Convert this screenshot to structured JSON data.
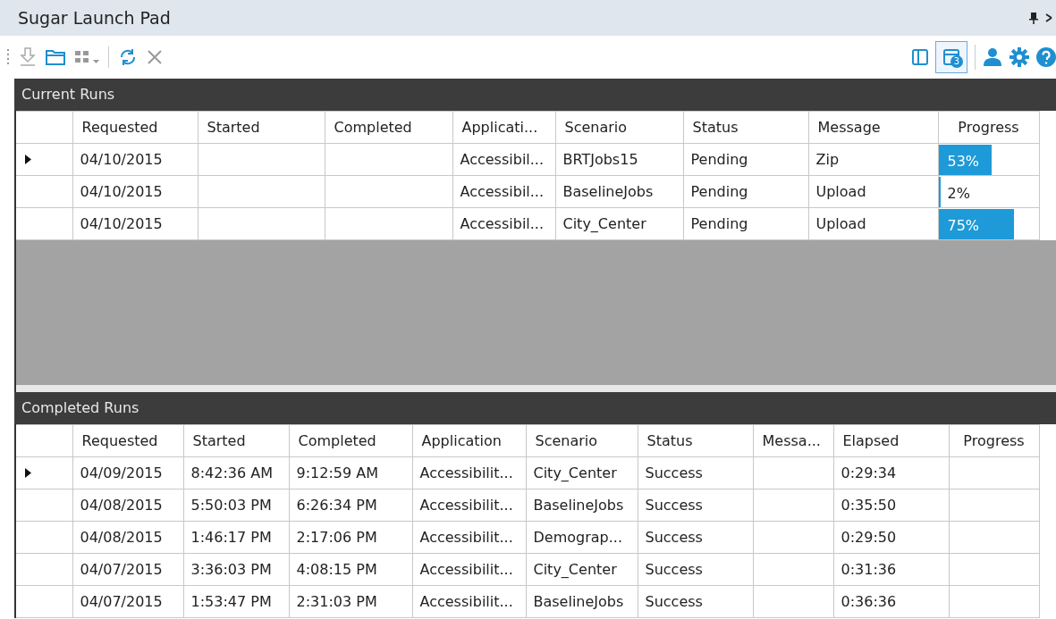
{
  "window": {
    "title": "Sugar Launch Pad"
  },
  "toolbar": {
    "badge": "3"
  },
  "current_runs": {
    "title": "Current Runs",
    "columns": [
      "Requested",
      "Started",
      "Completed",
      "Applicati...",
      "Scenario",
      "Status",
      "Message",
      "Progress"
    ],
    "rows": [
      {
        "selected": true,
        "cells": [
          "04/10/2015",
          "",
          "",
          "Accessibil...",
          "BRTJobs15",
          "Pending",
          "Zip"
        ],
        "progress": {
          "level": 0.53,
          "label": "53%"
        }
      },
      {
        "selected": false,
        "cells": [
          "04/10/2015",
          "",
          "",
          "Accessibil...",
          "BaselineJobs",
          "Pending",
          "Upload"
        ],
        "progress": {
          "level": 0.02,
          "label": "2%"
        }
      },
      {
        "selected": false,
        "cells": [
          "04/10/2015",
          "",
          "",
          "Accessibil...",
          "City_Center",
          "Pending",
          "Upload"
        ],
        "progress": {
          "level": 0.75,
          "label": "75%"
        }
      }
    ]
  },
  "completed_runs": {
    "title": "Completed Runs",
    "columns": [
      "Requested",
      "Started",
      "Completed",
      "Application",
      "Scenario",
      "Status",
      "Messa...",
      "Elapsed",
      "Progress"
    ],
    "rows": [
      {
        "selected": true,
        "cells": [
          "04/09/2015",
          "8:42:36 AM",
          "9:12:59 AM",
          "Accessibilit...",
          "City_Center",
          "Success",
          "",
          "0:29:34",
          ""
        ]
      },
      {
        "selected": false,
        "cells": [
          "04/08/2015",
          "5:50:03 PM",
          "6:26:34 PM",
          "Accessibilit...",
          "BaselineJobs",
          "Success",
          "",
          "0:35:50",
          ""
        ]
      },
      {
        "selected": false,
        "cells": [
          "04/08/2015",
          "1:46:17 PM",
          "2:17:06 PM",
          "Accessibilit...",
          "Demograp...",
          "Success",
          "",
          "0:29:50",
          ""
        ]
      },
      {
        "selected": false,
        "cells": [
          "04/07/2015",
          "3:36:03 PM",
          "4:08:15 PM",
          "Accessibilit...",
          "City_Center",
          "Success",
          "",
          "0:31:36",
          ""
        ]
      },
      {
        "selected": false,
        "cells": [
          "04/07/2015",
          "1:53:47 PM",
          "2:31:03 PM",
          "Accessibilit...",
          "BaselineJobs",
          "Success",
          "",
          "0:36:36",
          ""
        ]
      }
    ]
  }
}
